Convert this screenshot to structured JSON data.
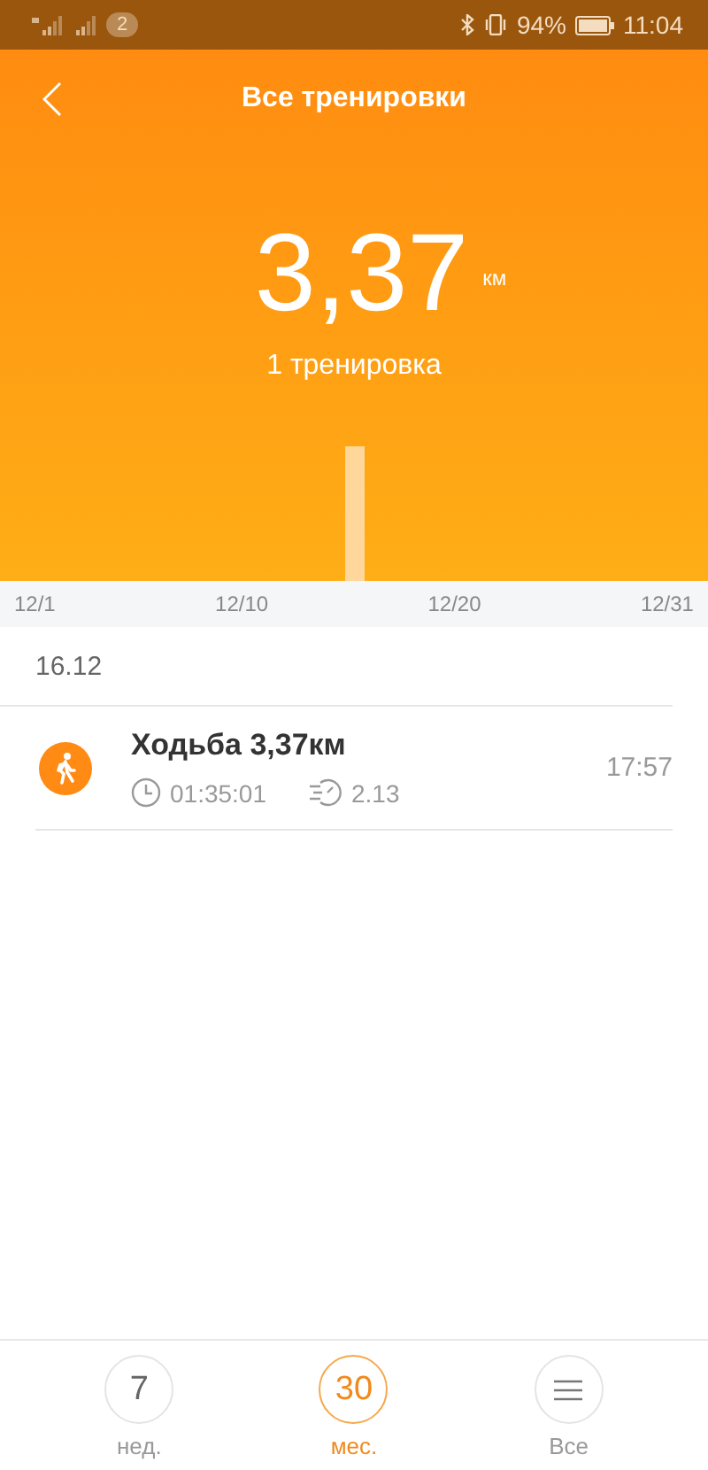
{
  "status_bar": {
    "badge": "2",
    "battery": "94%",
    "time": "11:04"
  },
  "header": {
    "title": "Все тренировки",
    "distance": "3,37",
    "unit": "км",
    "count": "1 тренировка"
  },
  "axis_labels": [
    "12/1",
    "12/10",
    "12/20",
    "12/31"
  ],
  "date": "16.12",
  "workouts": [
    {
      "title": "Ходьба 3,37км",
      "duration": "01:35:01",
      "pace": "2.13",
      "time": "17:57"
    }
  ],
  "tabs": [
    {
      "kind": "number",
      "value": "7",
      "label": "нед.",
      "selected": false
    },
    {
      "kind": "number",
      "value": "30",
      "label": "мес.",
      "selected": true
    },
    {
      "kind": "menu",
      "label": "Все",
      "selected": false
    }
  ]
}
